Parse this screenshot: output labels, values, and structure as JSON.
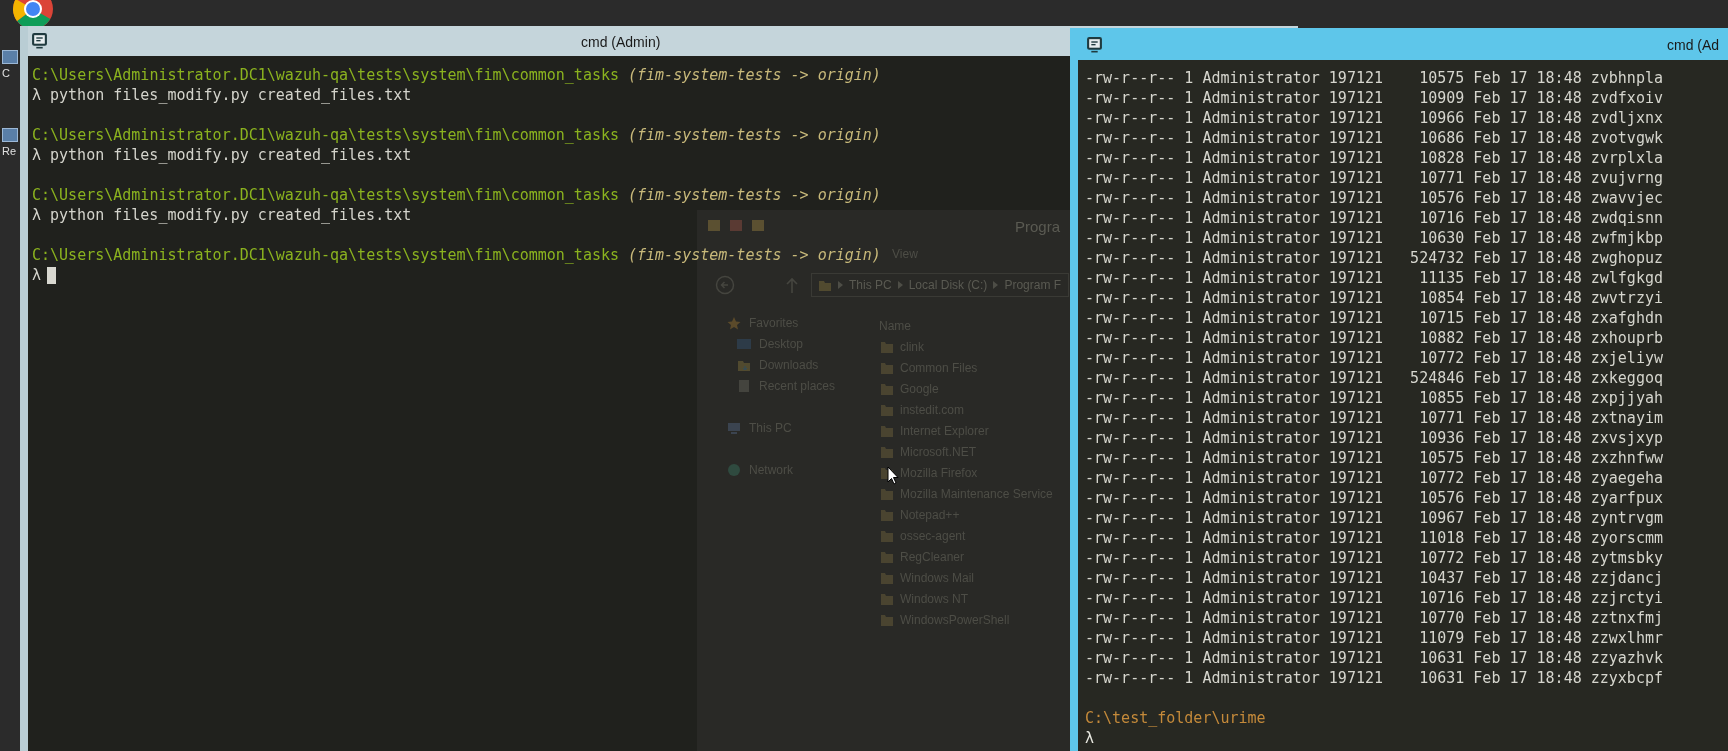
{
  "desktop": {
    "icons": [
      {
        "label": "C"
      },
      {
        "label": "Re"
      }
    ]
  },
  "left_window": {
    "title": "cmd (Admin)",
    "active": false,
    "lines": [
      {
        "kind": "prompt",
        "path": "C:\\Users\\Administrator.DC1\\wazuh-qa\\tests\\system\\fim\\common_tasks",
        "branch": "(fim-system-tests -> origin)"
      },
      {
        "kind": "command",
        "prompt": "λ",
        "text": "python files_modify.py created_files.txt"
      },
      {
        "kind": "blank"
      },
      {
        "kind": "prompt",
        "path": "C:\\Users\\Administrator.DC1\\wazuh-qa\\tests\\system\\fim\\common_tasks",
        "branch": "(fim-system-tests -> origin)"
      },
      {
        "kind": "command",
        "prompt": "λ",
        "text": "python files_modify.py created_files.txt"
      },
      {
        "kind": "blank"
      },
      {
        "kind": "prompt",
        "path": "C:\\Users\\Administrator.DC1\\wazuh-qa\\tests\\system\\fim\\common_tasks",
        "branch": "(fim-system-tests -> origin)"
      },
      {
        "kind": "command",
        "prompt": "λ",
        "text": "python files_modify.py created_files.txt"
      },
      {
        "kind": "blank"
      },
      {
        "kind": "prompt",
        "path": "C:\\Users\\Administrator.DC1\\wazuh-qa\\tests\\system\\fim\\common_tasks",
        "branch": "(fim-system-tests -> origin)"
      },
      {
        "kind": "input",
        "prompt": "λ",
        "cursor": true
      }
    ]
  },
  "explorer_behind": {
    "title": "Progra",
    "ribbon_tab": "View",
    "breadcrumb": [
      "This PC",
      "Local Disk (C:)",
      "Program F"
    ],
    "nav": [
      {
        "label": "Favorites",
        "kind": "star",
        "children": [
          {
            "label": "Desktop",
            "kind": "screen"
          },
          {
            "label": "Downloads",
            "kind": "folder"
          },
          {
            "label": "Recent places",
            "kind": "doc"
          }
        ]
      },
      {
        "label": "This PC",
        "kind": "pc"
      },
      {
        "label": "Network",
        "kind": "globe"
      }
    ],
    "column": "Name",
    "folders": [
      "clink",
      "Common Files",
      "Google",
      "instedit.com",
      "Internet Explorer",
      "Microsoft.NET",
      "Mozilla Firefox",
      "Mozilla Maintenance Service",
      "Notepad++",
      "ossec-agent",
      "RegCleaner",
      "Windows Mail",
      "Windows NT",
      "WindowsPowerShell"
    ]
  },
  "right_window": {
    "title": "cmd (Ad",
    "active": true,
    "rows": [
      "-rw-r--r-- 1 Administrator 197121    10575 Feb 17 18:48 zvbhnpla",
      "-rw-r--r-- 1 Administrator 197121    10909 Feb 17 18:48 zvdfxoiv",
      "-rw-r--r-- 1 Administrator 197121    10966 Feb 17 18:48 zvdljxnx",
      "-rw-r--r-- 1 Administrator 197121    10686 Feb 17 18:48 zvotvgwk",
      "-rw-r--r-- 1 Administrator 197121    10828 Feb 17 18:48 zvrplxla",
      "-rw-r--r-- 1 Administrator 197121    10771 Feb 17 18:48 zvujvrng",
      "-rw-r--r-- 1 Administrator 197121    10576 Feb 17 18:48 zwavvjec",
      "-rw-r--r-- 1 Administrator 197121    10716 Feb 17 18:48 zwdqisnn",
      "-rw-r--r-- 1 Administrator 197121    10630 Feb 17 18:48 zwfmjkbp",
      "-rw-r--r-- 1 Administrator 197121   524732 Feb 17 18:48 zwghopuz",
      "-rw-r--r-- 1 Administrator 197121    11135 Feb 17 18:48 zwlfgkgd",
      "-rw-r--r-- 1 Administrator 197121    10854 Feb 17 18:48 zwvtrzyi",
      "-rw-r--r-- 1 Administrator 197121    10715 Feb 17 18:48 zxafghdn",
      "-rw-r--r-- 1 Administrator 197121    10882 Feb 17 18:48 zxhouprb",
      "-rw-r--r-- 1 Administrator 197121    10772 Feb 17 18:48 zxjeliyw",
      "-rw-r--r-- 1 Administrator 197121   524846 Feb 17 18:48 zxkeggoq",
      "-rw-r--r-- 1 Administrator 197121    10855 Feb 17 18:48 zxpjjyah",
      "-rw-r--r-- 1 Administrator 197121    10771 Feb 17 18:48 zxtnayim",
      "-rw-r--r-- 1 Administrator 197121    10936 Feb 17 18:48 zxvsjxyp",
      "-rw-r--r-- 1 Administrator 197121    10575 Feb 17 18:48 zxzhnfww",
      "-rw-r--r-- 1 Administrator 197121    10772 Feb 17 18:48 zyaegeha",
      "-rw-r--r-- 1 Administrator 197121    10576 Feb 17 18:48 zyarfpux",
      "-rw-r--r-- 1 Administrator 197121    10967 Feb 17 18:48 zyntrvgm",
      "-rw-r--r-- 1 Administrator 197121    11018 Feb 17 18:48 zyorscmm",
      "-rw-r--r-- 1 Administrator 197121    10772 Feb 17 18:48 zytmsbky",
      "-rw-r--r-- 1 Administrator 197121    10437 Feb 17 18:48 zzjdancj",
      "-rw-r--r-- 1 Administrator 197121    10716 Feb 17 18:48 zzjrctyi",
      "-rw-r--r-- 1 Administrator 197121    10770 Feb 17 18:48 zztnxfmj",
      "-rw-r--r-- 1 Administrator 197121    11079 Feb 17 18:48 zzwxlhmr",
      "-rw-r--r-- 1 Administrator 197121    10631 Feb 17 18:48 zzyazhvk",
      "-rw-r--r-- 1 Administrator 197121    10631 Feb 17 18:48 zzyxbcpf"
    ],
    "prompt_path": "C:\\test_folder\\urime",
    "prompt": "λ"
  }
}
